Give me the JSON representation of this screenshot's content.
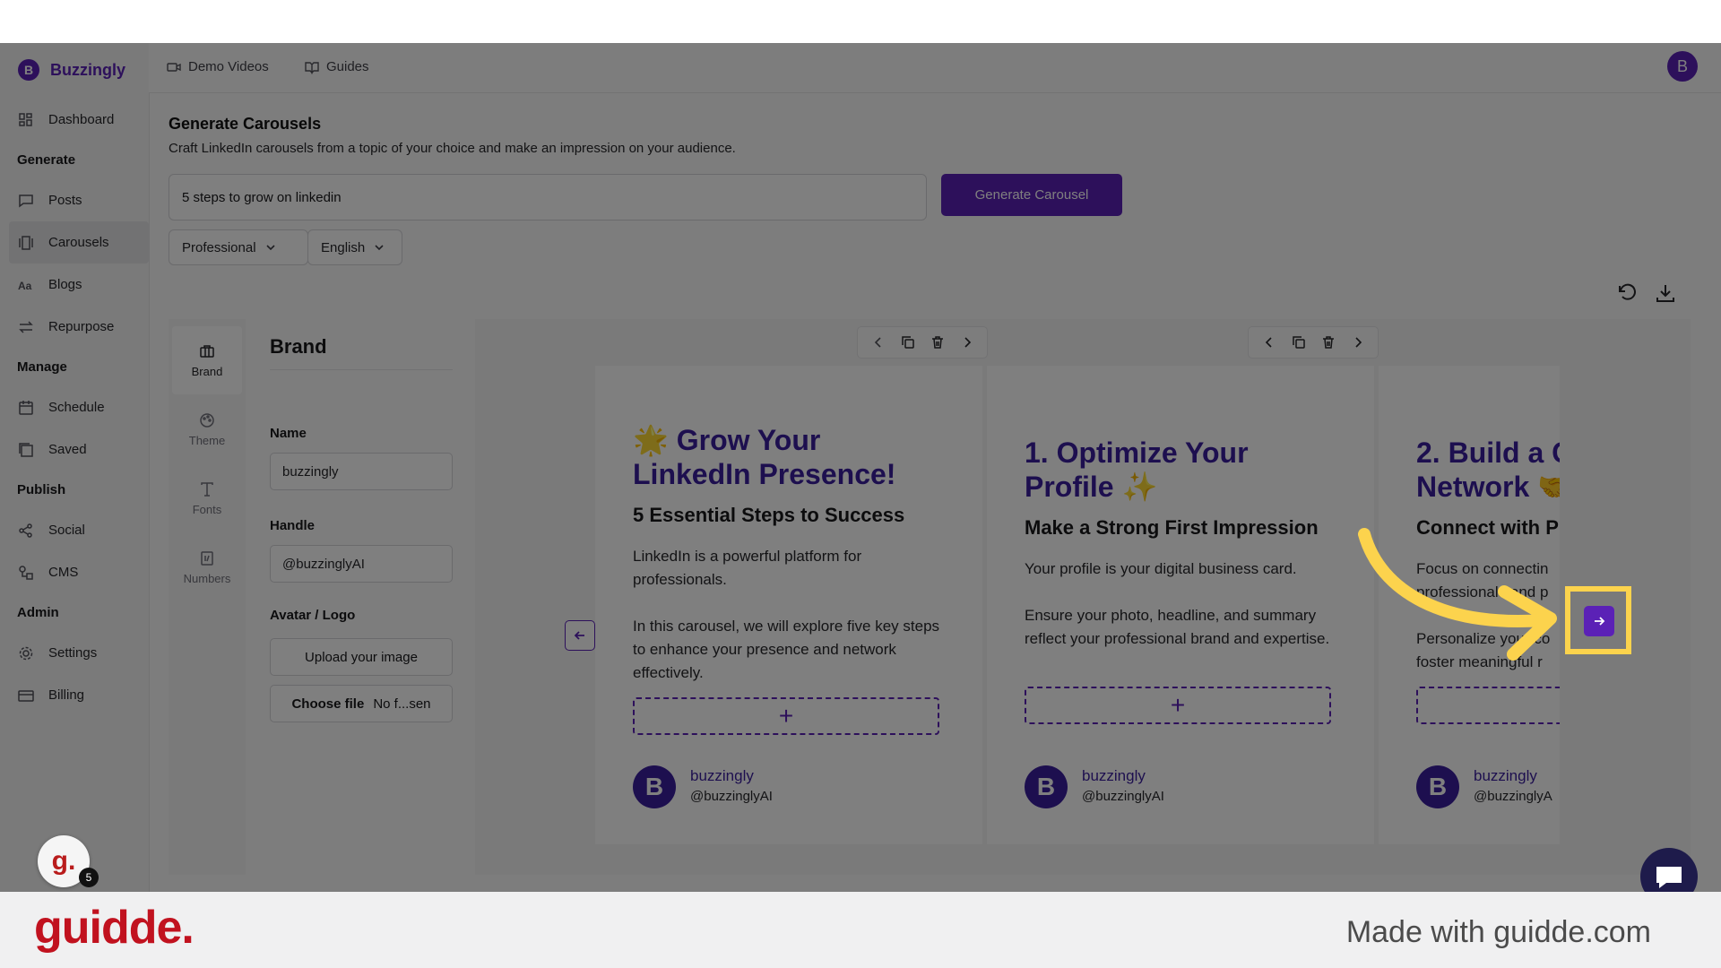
{
  "app": {
    "logo_letter": "B",
    "name": "Buzzingly",
    "user_initial": "B"
  },
  "topbar": {
    "demo_videos": "Demo Videos",
    "guides": "Guides"
  },
  "sidebar": {
    "dashboard": "Dashboard",
    "section_generate": "Generate",
    "posts": "Posts",
    "carousels": "Carousels",
    "blogs": "Blogs",
    "repurpose": "Repurpose",
    "section_manage": "Manage",
    "schedule": "Schedule",
    "saved": "Saved",
    "section_publish": "Publish",
    "social": "Social",
    "cms": "CMS",
    "section_admin": "Admin",
    "settings": "Settings",
    "billing": "Billing"
  },
  "page": {
    "title": "Generate Carousels",
    "subtitle": "Craft LinkedIn carousels from a topic of your choice and make an impression on your audience.",
    "topic_value": "5 steps to grow on linkedin",
    "generate_label": "Generate Carousel",
    "tone": "Professional",
    "language": "English"
  },
  "editor_tabs": {
    "brand": "Brand",
    "theme": "Theme",
    "fonts": "Fonts",
    "numbers": "Numbers"
  },
  "brand_panel": {
    "title": "Brand",
    "name_label": "Name",
    "name_value": "buzzingly",
    "handle_label": "Handle",
    "handle_value": "@buzzinglyAI",
    "avatar_label": "Avatar / Logo",
    "upload_label": "Upload your image",
    "choose_file": "Choose file",
    "no_file": "No f...sen"
  },
  "slides": [
    {
      "title_line1": "🌟 Grow Your",
      "title_line2": "LinkedIn Presence!",
      "subtitle": "5 Essential Steps to Success",
      "para1": "LinkedIn is a powerful platform for professionals.",
      "para2": "In this carousel, we will explore five key steps to enhance your presence and network effectively.",
      "avatar": "B",
      "name": "buzzingly",
      "handle": "@buzzinglyAI"
    },
    {
      "title_line1": "1. Optimize Your",
      "title_line2": "Profile ✨",
      "subtitle": "Make a Strong First Impression",
      "para1": "Your profile is your digital business card.",
      "para2": "Ensure your photo, headline, and summary reflect your professional brand and expertise.",
      "avatar": "B",
      "name": "buzzingly",
      "handle": "@buzzinglyAI"
    },
    {
      "title_line1": "2. Build a C",
      "title_line2": "Network 🤝",
      "subtitle": "Connect with P",
      "para1": "Focus on connectin professionals and p",
      "para2": "Personalize your co foster meaningful r",
      "avatar": "B",
      "name": "buzzingly",
      "handle": "@buzzinglyA"
    }
  ],
  "add_symbol": "+",
  "guidde": {
    "badge": "g.",
    "count": "5"
  },
  "footer": {
    "logo": "guidde.",
    "made_with": "Made with guidde.com"
  },
  "colors": {
    "accent": "#5b21b6",
    "slide_title": "#3b1f9e",
    "highlight": "#fcd34d",
    "guidde_red": "#c1121f"
  }
}
